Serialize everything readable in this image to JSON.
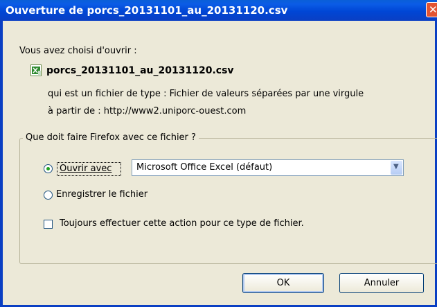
{
  "window": {
    "title": "Ouverture de porcs_20131101_au_20131120.csv"
  },
  "intro": "Vous avez choisi d'ouvrir :",
  "file": {
    "name": "porcs_20131101_au_20131120.csv",
    "type_text": "qui est un fichier de type : Fichier de valeurs séparées par une virgule",
    "from_text": "à partir de : http://www2.uniporc-ouest.com"
  },
  "group": {
    "legend": "Que doit faire Firefox avec ce fichier ?",
    "open_with_label": "Ouvrir avec",
    "open_with_app": "Microsoft Office Excel (défaut)",
    "save_label": "Enregistrer le fichier",
    "always_label": "Toujours effectuer cette action pour ce type de fichier."
  },
  "buttons": {
    "ok": "OK",
    "cancel": "Annuler"
  }
}
